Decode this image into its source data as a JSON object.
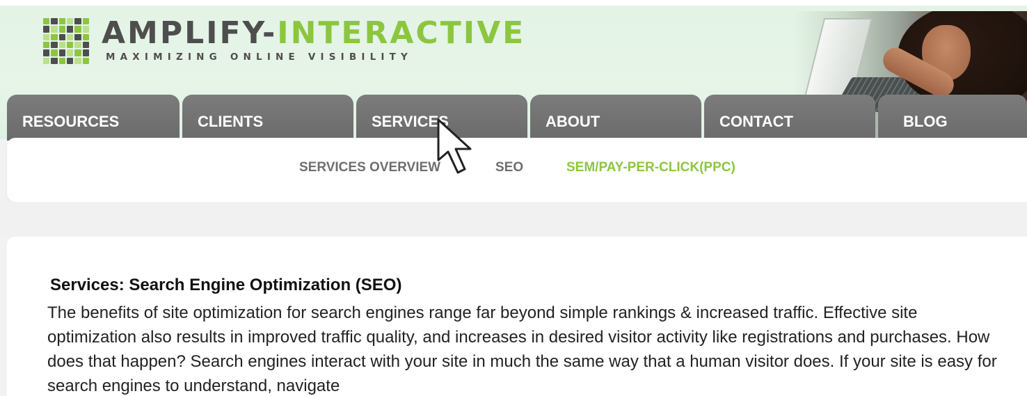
{
  "brand": {
    "name_part_a": "AMPLIFY-",
    "name_part_b": "INTERACTIVE",
    "tagline": "MAXIMIZING ONLINE VISIBILITY",
    "logo_icon": "pixel-grid-logo-icon",
    "colors": {
      "gray": "#4e4e4e",
      "green": "#8cc63f"
    }
  },
  "nav": {
    "tabs": [
      {
        "label": "RESOURCES"
      },
      {
        "label": "CLIENTS"
      },
      {
        "label": "SERVICES"
      },
      {
        "label": "ABOUT"
      },
      {
        "label": "CONTACT"
      },
      {
        "label": "BLOG"
      }
    ],
    "tab_color": "#707070"
  },
  "subnav": {
    "links": [
      {
        "label": "SERVICES OVERVIEW"
      },
      {
        "label": "SEO"
      },
      {
        "label": "SEM/PAY-PER-CLICK(PPC)"
      }
    ],
    "highlight_color": "#8cc63f"
  },
  "content": {
    "heading": "Services: Search Engine Optimization (SEO)",
    "body": "The benefits of site optimization for search engines range far beyond simple rankings & increased traffic. Effective site optimization also results in improved traffic quality, and increases in desired visitor activity like registrations and purchases. How does that happen? Search engines interact with your site in much the same way that a human visitor does. If your site is easy for search engines to understand, navigate"
  },
  "cursor": {
    "icon": "arrow-pointer-icon"
  }
}
